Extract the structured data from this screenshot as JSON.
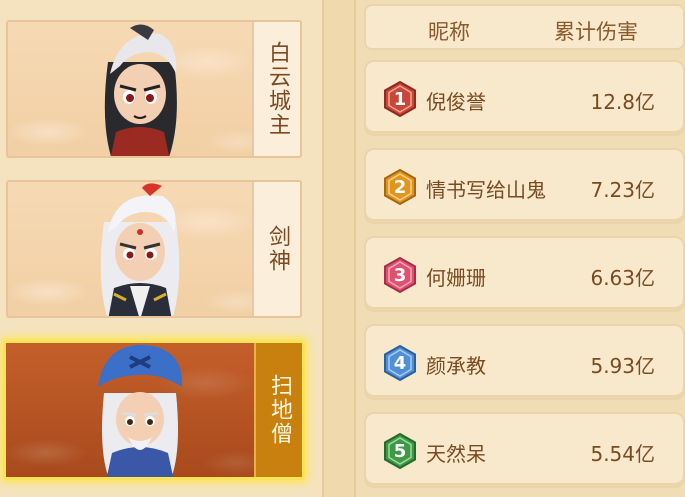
{
  "bosses": [
    {
      "name": "白云城主",
      "selected": false
    },
    {
      "name": "剑神",
      "selected": false
    },
    {
      "name": "扫地僧",
      "selected": true
    }
  ],
  "table": {
    "headers": {
      "nickname": "昵称",
      "damage": "累计伤害"
    },
    "rows": [
      {
        "rank": "1",
        "nickname": "倪俊誉",
        "damage": "12.8亿",
        "badge_color": "#c8463a"
      },
      {
        "rank": "2",
        "nickname": "情书写给山鬼",
        "damage": "7.23亿",
        "badge_color": "#e0951e"
      },
      {
        "rank": "3",
        "nickname": "何姗珊",
        "damage": "6.63亿",
        "badge_color": "#e0506f"
      },
      {
        "rank": "4",
        "nickname": "颜承教",
        "damage": "5.93亿",
        "badge_color": "#4f8fd6"
      },
      {
        "rank": "5",
        "nickname": "天然呆",
        "damage": "5.54亿",
        "badge_color": "#3f9a45"
      }
    ]
  }
}
